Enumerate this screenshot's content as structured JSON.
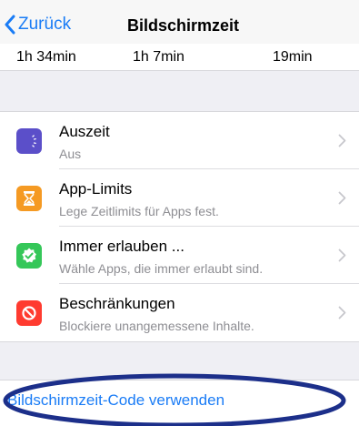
{
  "nav": {
    "back_label": "Zurück",
    "title": "Bildschirmzeit"
  },
  "usage": {
    "values": [
      "1h 34min",
      "1h 7min",
      "19min"
    ]
  },
  "settings": [
    {
      "title": "Auszeit",
      "subtitle": "Aus",
      "icon": "downtime-icon",
      "color": "#5b4fc9"
    },
    {
      "title": "App-Limits",
      "subtitle": "Lege Zeitlimits für Apps fest.",
      "icon": "hourglass-icon",
      "color": "#f59a23"
    },
    {
      "title": "Immer erlauben ...",
      "subtitle": "Wähle Apps, die immer erlaubt sind.",
      "icon": "checkmark-badge-icon",
      "color": "#35c759"
    },
    {
      "title": "Beschränkungen",
      "subtitle": "Blockiere unangemessene Inhalte.",
      "icon": "restriction-icon",
      "color": "#ff3b30"
    }
  ],
  "code_link": "Bildschirmzeit-Code verwenden",
  "colors": {
    "accent": "#1a7cf6",
    "annotation": "#1c2f8a"
  }
}
